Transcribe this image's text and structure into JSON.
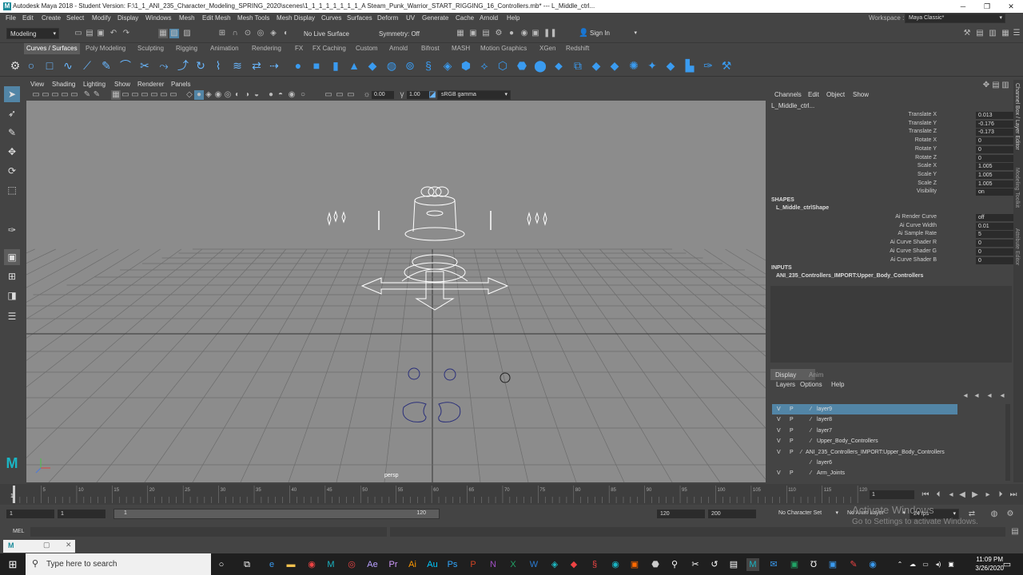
{
  "window": {
    "title": "Autodesk Maya 2018 - Student Version: F:\\1_1_ANI_235_Character_Modeling_SPRING_2020\\scenes\\1_1_1_1_1_1_1_1_A Steam_Punk_Warrior_START_RIGGING_16_Controllers.mb* --- L_Middle_ctrl..."
  },
  "menu": [
    "File",
    "Edit",
    "Create",
    "Select",
    "Modify",
    "Display",
    "Windows",
    "Mesh",
    "Edit Mesh",
    "Mesh Tools",
    "Mesh Display",
    "Curves",
    "Surfaces",
    "Deform",
    "UV",
    "Generate",
    "Cache",
    "Arnold",
    "Help"
  ],
  "workspace": {
    "label": "Workspace :",
    "value": "Maya Classic*"
  },
  "statusline": {
    "mode": "Modeling",
    "live": "No Live Surface",
    "symmetry": "Symmetry: Off",
    "signin": "Sign In"
  },
  "shelf_tabs": [
    "Curves / Surfaces",
    "Poly Modeling",
    "Sculpting",
    "Rigging",
    "Animation",
    "Rendering",
    "FX",
    "FX Caching",
    "Custom",
    "Arnold",
    "Bifrost",
    "MASH",
    "Motion Graphics",
    "XGen",
    "Redshift"
  ],
  "viewport": {
    "menu": [
      "View",
      "Shading",
      "Lighting",
      "Show",
      "Renderer",
      "Panels"
    ],
    "exposure": "0.00",
    "gamma": "1.00",
    "colorspace": "sRGB gamma",
    "camera": "persp"
  },
  "channel_box": {
    "menu": [
      "Channels",
      "Edit",
      "Object",
      "Show"
    ],
    "object": "L_Middle_ctrl...",
    "attrs": [
      {
        "name": "Translate X",
        "value": "0.013"
      },
      {
        "name": "Translate Y",
        "value": "-0.176"
      },
      {
        "name": "Translate Z",
        "value": "-0.173"
      },
      {
        "name": "Rotate X",
        "value": "0"
      },
      {
        "name": "Rotate Y",
        "value": "0"
      },
      {
        "name": "Rotate Z",
        "value": "0"
      },
      {
        "name": "Scale X",
        "value": "1.005"
      },
      {
        "name": "Scale Y",
        "value": "1.005"
      },
      {
        "name": "Scale Z",
        "value": "1.005"
      },
      {
        "name": "Visibility",
        "value": "on"
      }
    ],
    "shapes_header": "SHAPES",
    "shape_name": "L_Middle_ctrlShape",
    "shape_attrs": [
      {
        "name": "Ai Render Curve",
        "value": "off"
      },
      {
        "name": "Ai Curve Width",
        "value": "0.01"
      },
      {
        "name": "Ai Sample Rate",
        "value": "5"
      },
      {
        "name": "Ai Curve Shader R",
        "value": "0"
      },
      {
        "name": "Ai Curve Shader G",
        "value": "0"
      },
      {
        "name": "Ai Curve Shader B",
        "value": "0"
      }
    ],
    "inputs_header": "INPUTS",
    "input_name": "ANI_235_Controllers_IMPORT:Upper_Body_Controllers"
  },
  "side_tabs": [
    "Channel Box / Layer Editor",
    "Modeling Toolkit",
    "Attribute Editor"
  ],
  "layer_editor": {
    "tabs": [
      "Display",
      "Anim"
    ],
    "menu": [
      "Layers",
      "Options",
      "Help"
    ],
    "rows": [
      {
        "v": "V",
        "p": "P",
        "name": "layer9",
        "selected": true
      },
      {
        "v": "V",
        "p": "P",
        "name": "layer8",
        "selected": false
      },
      {
        "v": "V",
        "p": "P",
        "name": "layer7",
        "selected": false
      },
      {
        "v": "V",
        "p": "P",
        "name": "Upper_Body_Controllers",
        "selected": false
      },
      {
        "v": "V",
        "p": "P",
        "name": "ANI_235_Controllers_IMPORT:Upper_Body_Controllers",
        "selected": false
      },
      {
        "v": "",
        "p": "",
        "name": "layer6",
        "selected": false
      },
      {
        "v": "V",
        "p": "P",
        "name": "Arm_Joints",
        "selected": false
      }
    ]
  },
  "timeslider": {
    "ticks": [
      "5",
      "10",
      "15",
      "20",
      "25",
      "30",
      "35",
      "40",
      "45",
      "50",
      "55",
      "60",
      "65",
      "70",
      "75",
      "80",
      "85",
      "90",
      "95",
      "100",
      "105",
      "110",
      "115",
      "120"
    ],
    "start_label": "1",
    "current": "1"
  },
  "range": {
    "start": "1",
    "anim_start": "1",
    "slider_start": "1",
    "slider_end": "120",
    "end": "120",
    "anim_end": "200",
    "char_set": "No Character Set",
    "anim_layer": "No Anim Layer",
    "fps": "24 fps"
  },
  "command": {
    "lang": "MEL"
  },
  "watermark": {
    "line1": "Activate Windows",
    "line2": "Go to Settings to activate Windows."
  },
  "taskbar": {
    "search_placeholder": "Type here to search",
    "time": "11:09 PM",
    "date": "3/26/2020"
  }
}
